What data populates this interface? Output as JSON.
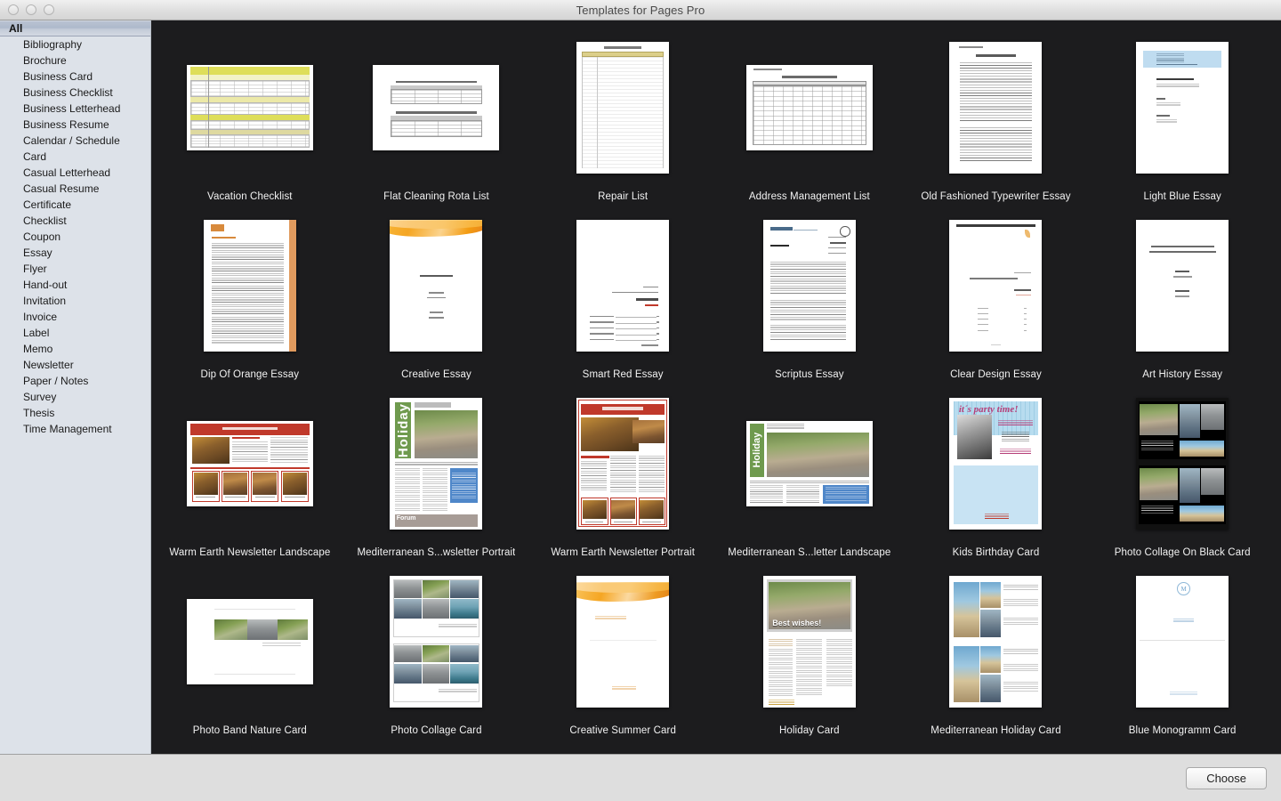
{
  "window": {
    "title": "Templates for Pages Pro",
    "traffic_lights": [
      "close-button",
      "minimize-button",
      "zoom-button"
    ]
  },
  "sidebar": {
    "selected": "All",
    "items": [
      {
        "label": "All",
        "selected": true
      },
      {
        "label": "Bibliography",
        "selected": false
      },
      {
        "label": "Brochure",
        "selected": false
      },
      {
        "label": "Business Card",
        "selected": false
      },
      {
        "label": "Business Checklist",
        "selected": false
      },
      {
        "label": "Business Letterhead",
        "selected": false
      },
      {
        "label": "Business Resume",
        "selected": false
      },
      {
        "label": "Calendar / Schedule",
        "selected": false
      },
      {
        "label": "Card",
        "selected": false
      },
      {
        "label": "Casual Letterhead",
        "selected": false
      },
      {
        "label": "Casual Resume",
        "selected": false
      },
      {
        "label": "Certificate",
        "selected": false
      },
      {
        "label": "Checklist",
        "selected": false
      },
      {
        "label": "Coupon",
        "selected": false
      },
      {
        "label": "Essay",
        "selected": false
      },
      {
        "label": "Flyer",
        "selected": false
      },
      {
        "label": "Hand-out",
        "selected": false
      },
      {
        "label": "Invitation",
        "selected": false
      },
      {
        "label": "Invoice",
        "selected": false
      },
      {
        "label": "Label",
        "selected": false
      },
      {
        "label": "Memo",
        "selected": false
      },
      {
        "label": "Newsletter",
        "selected": false
      },
      {
        "label": "Paper / Notes",
        "selected": false
      },
      {
        "label": "Survey",
        "selected": false
      },
      {
        "label": "Thesis",
        "selected": false
      },
      {
        "label": "Time Management",
        "selected": false
      }
    ]
  },
  "gallery": {
    "columns": 6,
    "templates": [
      {
        "label": "Vacation Checklist",
        "art": "vacation-checklist",
        "orientation": "landscape",
        "heading": "Vacation  Checklist  2012"
      },
      {
        "label": "Flat Cleaning Rota List",
        "art": "flat-cleaning-rota",
        "orientation": "landscape",
        "heading": "Flat Cleaning List"
      },
      {
        "label": "Repair List",
        "art": "repair-list",
        "orientation": "portrait-tall",
        "heading": "Repair list"
      },
      {
        "label": "Address Management List",
        "art": "address-management",
        "orientation": "landscape",
        "heading": "Address management list"
      },
      {
        "label": "Old Fashioned Typewriter Essay",
        "art": "typewriter-essay",
        "orientation": "portrait-tall",
        "heading": "Essay: Topic of Article"
      },
      {
        "label": "Light Blue Essay",
        "art": "light-blue-essay",
        "orientation": "portrait-tall",
        "heading": ""
      },
      {
        "label": "Dip Of Orange Essay",
        "art": "dip-orange-essay",
        "orientation": "portrait",
        "heading": "Title of essay"
      },
      {
        "label": "Creative Essay",
        "art": "creative-essay",
        "orientation": "portrait",
        "heading": "Write Title goes here"
      },
      {
        "label": "Smart Red Essay",
        "art": "smart-red-essay",
        "orientation": "portrait",
        "heading": "Main Title"
      },
      {
        "label": "Scriptus Essay",
        "art": "scriptus-essay",
        "orientation": "portrait",
        "heading": "Title of essay"
      },
      {
        "label": "Clear Design Essay",
        "art": "clear-design-essay",
        "orientation": "portrait",
        "heading": "YOUR TOPIC GOES HERE"
      },
      {
        "label": "Art History Essay",
        "art": "art-history-essay",
        "orientation": "portrait",
        "heading": "Analysis of \"The creation of Adam\" by Michelangelo Buonarroti in the Sistine Chapel"
      },
      {
        "label": "Warm Earth Newsletter Landscape",
        "art": "warm-earth-landscape",
        "orientation": "landscape",
        "heading": "COMPANY NAME"
      },
      {
        "label": "Mediterranean S...wsletter Portrait",
        "art": "mediterranean-portrait",
        "orientation": "portrait",
        "heading": "Holiday"
      },
      {
        "label": "Warm Earth Newsletter Portrait",
        "art": "warm-earth-portrait",
        "orientation": "portrait",
        "heading": "COMPANY NAME"
      },
      {
        "label": "Mediterranean S...letter Landscape",
        "art": "mediterranean-landscape",
        "orientation": "landscape",
        "heading": "Holiday"
      },
      {
        "label": "Kids Birthday Card",
        "art": "kids-birthday-card",
        "orientation": "portrait",
        "heading": "it´s party time!"
      },
      {
        "label": "Photo Collage On Black Card",
        "art": "photo-collage-black",
        "orientation": "portrait",
        "heading": ""
      },
      {
        "label": "Photo Band Nature Card",
        "art": "photo-band-nature",
        "orientation": "landscape",
        "heading": ""
      },
      {
        "label": "Photo Collage Card",
        "art": "photo-collage-card",
        "orientation": "portrait",
        "heading": "versatile summer 2012"
      },
      {
        "label": "Creative Summer Card",
        "art": "creative-summer-card",
        "orientation": "portrait",
        "heading": "Sample Text"
      },
      {
        "label": "Holiday Card",
        "art": "holiday-card",
        "orientation": "portrait",
        "heading": "Best wishes!"
      },
      {
        "label": "Mediterranean Holiday Card",
        "art": "mediterranean-holiday",
        "orientation": "portrait",
        "heading": ""
      },
      {
        "label": "Blue Monogramm Card",
        "art": "blue-monogramm-card",
        "orientation": "portrait",
        "heading": "M"
      }
    ]
  },
  "footer": {
    "choose_label": "Choose"
  },
  "colors": {
    "gallery_background": "#1c1c1e",
    "sidebar_background": "#dde2e9",
    "titlebar_background": "#e4e4e4",
    "footer_background": "#dedede",
    "label_text": "#f2f2f2",
    "accent_red": "#c0392b",
    "accent_green": "#6f9a4e",
    "accent_orange": "#e8a33d",
    "accent_blue": "#a8cde8",
    "accent_yellow": "#dede5a"
  }
}
